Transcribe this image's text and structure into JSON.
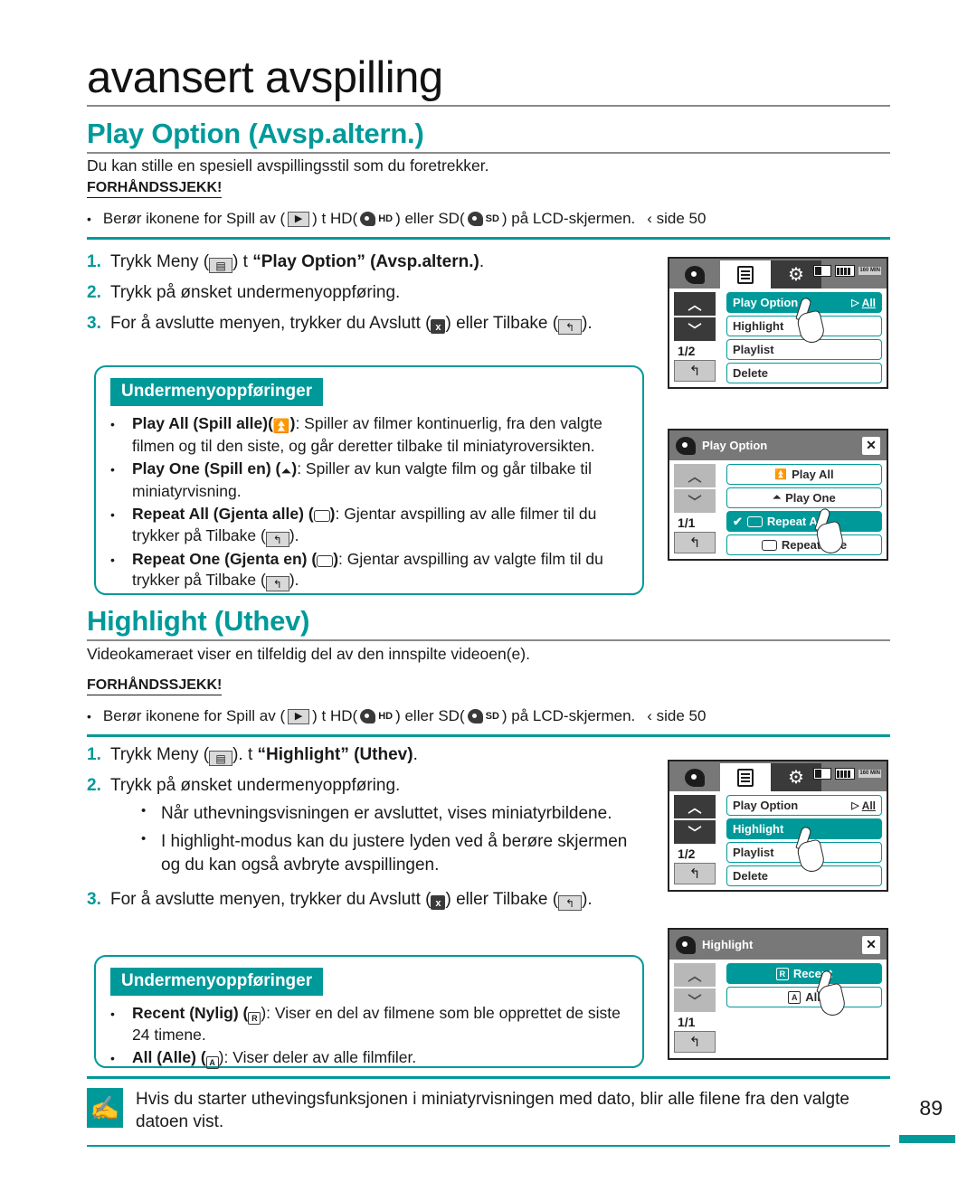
{
  "chapter": {
    "title": "avansert avspilling"
  },
  "page": {
    "number": "89"
  },
  "sections": [
    {
      "id": "play-option",
      "title": "Play Option (Avsp.altern.)",
      "lead": "Du kan stille en spesiell avspillingsstil som du foretrekker.",
      "precheck_label": "FORHÅNDSSJEKK!",
      "precheck": {
        "before": "Berør ikonene for Spill av (",
        "mid1": ") t  HD(",
        "hd": "HD",
        "mid2": ") eller SD(",
        "sd": "SD",
        "after": ") på LCD-skjermen.",
        "ref": "‹ side 50"
      },
      "steps": [
        {
          "num": "1.",
          "a": "Trykk Meny (",
          "b": ") t ",
          "bold": "“Play Option” (Avsp.altern.)",
          "c": "."
        },
        {
          "num": "2.",
          "a": "Trykk på ønsket undermenyoppføring."
        },
        {
          "num": "3.",
          "a": "For å avslutte menyen, trykker du Avslutt (",
          "b": ") eller Tilbake (",
          "c": ")."
        }
      ],
      "submenu": {
        "tag": "Undermenyoppføringer",
        "items": [
          {
            "bold": "Play All (Spill alle)",
            "icon": "play-all-icon",
            "rest": ": Spiller av filmer kontinuerlig, fra den valgte filmen og til den siste, og går deretter tilbake til miniatyroversikten."
          },
          {
            "bold": "Play One (Spill en) ",
            "icon": "play-one-icon",
            "rest": ": Spiller av kun valgte film og går tilbake til miniatyrvisning."
          },
          {
            "bold": "Repeat All (Gjenta alle) ",
            "icon": "repeat-all-icon",
            "rest": ": Gjentar avspilling av alle filmer til du trykker på Tilbake (",
            "tail": ")."
          },
          {
            "bold": "Repeat One (Gjenta en) ",
            "icon": "repeat-one-icon",
            "rest": ": Gjentar avspilling av valgte film til du trykker på Tilbake (",
            "tail": ")."
          }
        ]
      }
    },
    {
      "id": "highlight",
      "title": "Highlight (Uthev)",
      "lead": "Videokameraet viser en tilfeldig del av den innspilte videoen(e).",
      "precheck_label": "FORHÅNDSSJEKK!",
      "precheck": {
        "before": "Berør ikonene for Spill av (",
        "mid1": ") t  HD(",
        "hd": "HD",
        "mid2": ") eller SD(",
        "sd": "SD",
        "after": ") på LCD-skjermen.",
        "ref": "‹ side 50"
      },
      "steps": [
        {
          "num": "1.",
          "a": "Trykk Meny (",
          "b": "). t ",
          "bold": "“Highlight” (Uthev)",
          "c": "."
        },
        {
          "num": "2.",
          "a": "Trykk på ønsket undermenyoppføring.",
          "substeps": [
            "Når uthevningsvisningen er avsluttet, vises miniatyrbildene.",
            "I highlight-modus kan du justere lyden ved å berøre skjermen og du kan også avbryte avspillingen."
          ]
        },
        {
          "num": "3.",
          "a": "For å avslutte menyen, trykker du Avslutt (",
          "b": ") eller Tilbake (",
          "c": ")."
        }
      ],
      "submenu": {
        "tag": "Undermenyoppføringer",
        "items": [
          {
            "bold": "Recent (Nylig) (",
            "icon": "recent-icon",
            "rest": "): Viser en del av filmene som ble opprettet de siste 24 timene."
          },
          {
            "bold": "All (Alle) (",
            "icon": "all-icon",
            "rest": "): Viser deler av alle filmfiler."
          }
        ]
      }
    }
  ],
  "lcd_screens": [
    {
      "id": "menu-play-option",
      "kind": "tabbed",
      "tabs": [
        "reel-icon",
        "list-icon",
        "gear-icon"
      ],
      "status": {
        "card": "sd-card-icon",
        "battery": "battery-icon",
        "time": "160 MIN"
      },
      "pagecount": "1/2",
      "rows": [
        {
          "label": "Play Option",
          "selected": true,
          "tail_tri": "▷",
          "tail_label": "All"
        },
        {
          "label": "Highlight",
          "selected": false
        },
        {
          "label": "Playlist",
          "selected": false
        },
        {
          "label": "Delete",
          "selected": false
        }
      ],
      "hand_row": 0
    },
    {
      "id": "submenu-play-option",
      "kind": "titled",
      "title": "Play Option",
      "pagecount": "1/1",
      "rows": [
        {
          "label": "Play All",
          "icon": "play-all-icon",
          "selected": false
        },
        {
          "label": "Play One",
          "icon": "play-one-icon",
          "selected": false
        },
        {
          "label": "Repeat All",
          "icon": "repeat-all-icon",
          "selected": true,
          "check": "✔"
        },
        {
          "label": "Repeat One",
          "icon": "repeat-one-icon",
          "selected": false
        }
      ],
      "hand_row": 2
    },
    {
      "id": "menu-highlight",
      "kind": "tabbed",
      "tabs": [
        "reel-icon",
        "list-icon",
        "gear-icon"
      ],
      "status": {
        "card": "sd-card-icon",
        "battery": "battery-icon",
        "time": "160 MIN"
      },
      "pagecount": "1/2",
      "rows": [
        {
          "label": "Play Option",
          "selected": false,
          "tail_tri": "▷",
          "tail_label": "All"
        },
        {
          "label": "Highlight",
          "selected": true
        },
        {
          "label": "Playlist",
          "selected": false
        },
        {
          "label": "Delete",
          "selected": false
        }
      ],
      "hand_row": 1
    },
    {
      "id": "submenu-highlight",
      "kind": "titled",
      "title": "Highlight",
      "pagecount": "1/1",
      "rows": [
        {
          "label": "Recent",
          "icon": "recent-icon",
          "selected": true
        },
        {
          "label": "All",
          "icon": "all-icon",
          "selected": false
        }
      ],
      "hand_row": 0
    }
  ],
  "note": {
    "text": "Hvis du starter uthevingsfunksjonen i miniatyrvisningen med dato, blir alle filene fra den valgte datoen vist."
  },
  "colors": {
    "accent": "#00999a",
    "rule": "#8a8a8a",
    "lcd_gray": "#787878"
  }
}
